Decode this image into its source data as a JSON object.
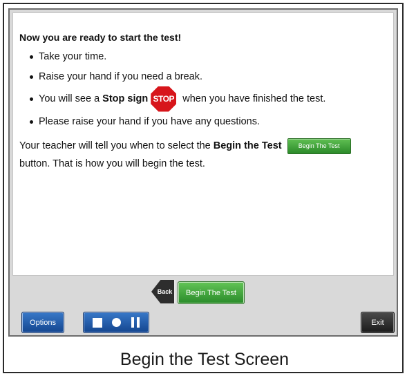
{
  "content": {
    "heading": "Now you are ready to start the test!",
    "bullets": {
      "b1": "Take your time.",
      "b2": "Raise your hand if you need a break.",
      "b3_pre": "You will see a ",
      "b3_bold": "Stop sign",
      "b3_post": " when you have finished the test.",
      "b4": "Please raise your hand if you have any questions."
    },
    "stop_sign_text": "STOP",
    "stop_sign_color": "#d7151b",
    "para_pre": "Your teacher will tell you when to select the ",
    "para_bold": "Begin the Test",
    "inline_button_label": "Begin The Test",
    "para_line2": "button. That is how you will begin the test."
  },
  "nav": {
    "back_label": "Back",
    "begin_label": "Begin The Test",
    "options_label": "Options",
    "exit_label": "Exit",
    "media_controls": [
      "stop-icon",
      "record-icon",
      "pause-icon"
    ]
  },
  "caption": "Begin the Test Screen",
  "colors": {
    "green_button": "#2a8b2a",
    "blue_button": "#14468f",
    "dark_button": "#1b1b1b"
  }
}
